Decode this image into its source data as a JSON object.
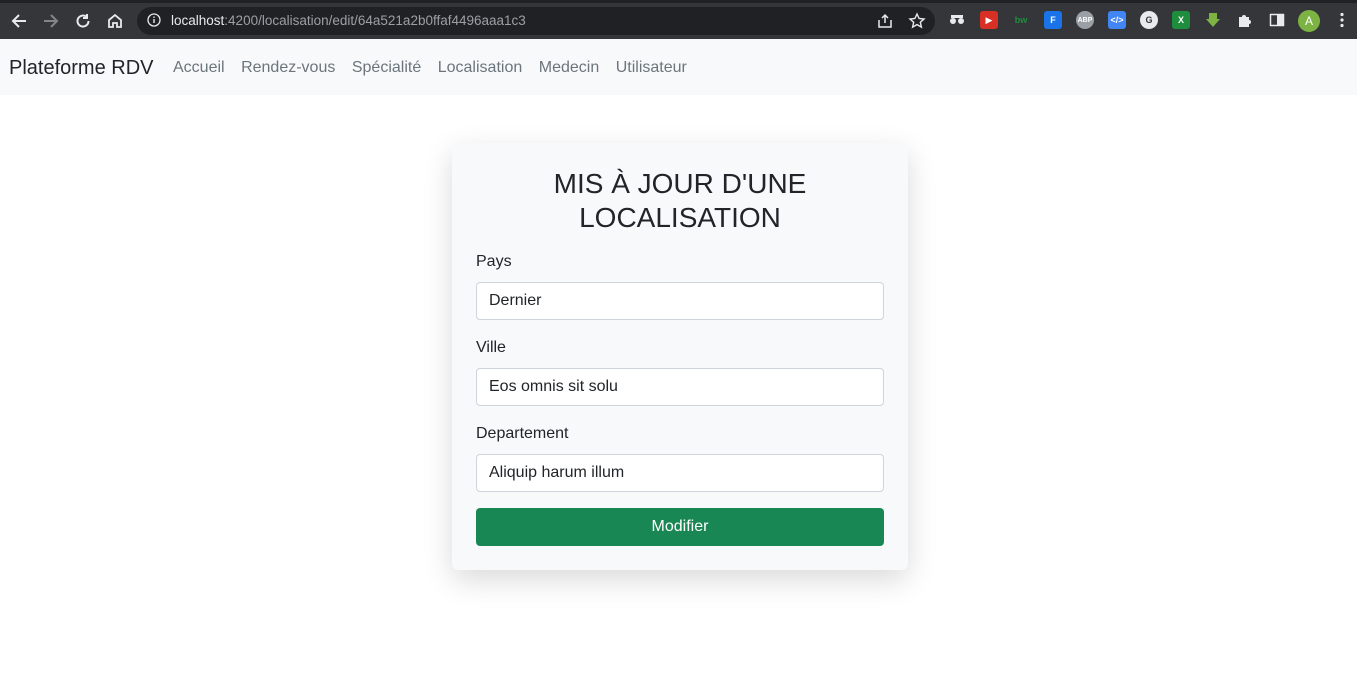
{
  "browser": {
    "url_host": "localhost",
    "url_rest": ":4200/localisation/edit/64a521a2b0ffaf4496aaa1c3",
    "profile_initial": "A"
  },
  "navbar": {
    "brand": "Plateforme RDV",
    "links": [
      "Accueil",
      "Rendez-vous",
      "Spécialité",
      "Localisation",
      "Medecin",
      "Utilisateur"
    ]
  },
  "form": {
    "title": "MIS À JOUR D'UNE LOCALISATION",
    "fields": [
      {
        "label": "Pays",
        "value": "Dernier"
      },
      {
        "label": "Ville",
        "value": "Eos omnis sit solu"
      },
      {
        "label": "Departement",
        "value": "Aliquip harum illum"
      }
    ],
    "submit_label": "Modifier"
  },
  "colors": {
    "navbar_bg": "#f8f9fa",
    "submit_bg": "#198754",
    "chrome_bg": "#35363a"
  }
}
